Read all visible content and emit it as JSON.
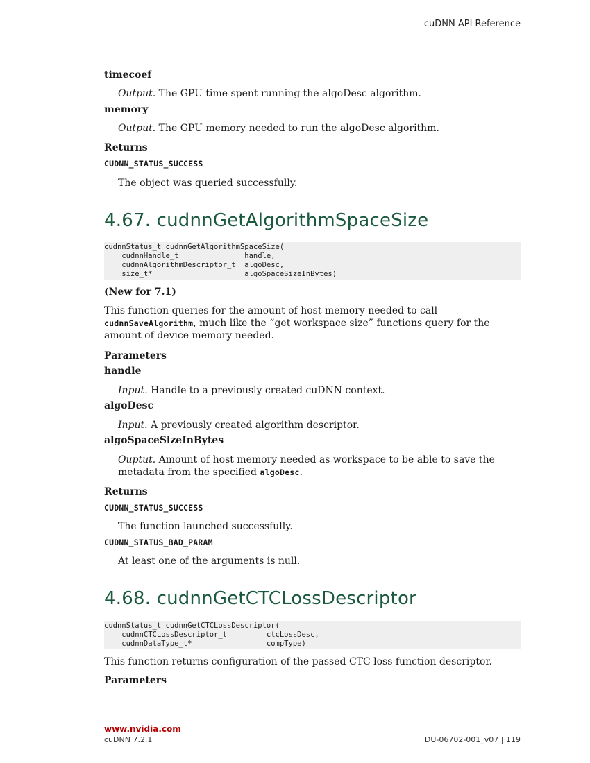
{
  "header": {
    "title": "cuDNN API Reference"
  },
  "prev_section": {
    "param_timecoef": {
      "name": "timecoef",
      "role": "Output.",
      "desc": "The GPU time spent running the algoDesc algorithm."
    },
    "param_memory": {
      "name": "memory",
      "role": "Output.",
      "desc": "The GPU memory needed to run the algoDesc algorithm."
    },
    "returns_label": "Returns",
    "return_success": {
      "code": "CUDNN_STATUS_SUCCESS",
      "desc": "The object was queried successfully."
    }
  },
  "section_467": {
    "heading": "4.67. cudnnGetAlgorithmSpaceSize",
    "code": "cudnnStatus_t cudnnGetAlgorithmSpaceSize(\n    cudnnHandle_t               handle,\n    cudnnAlgorithmDescriptor_t  algoDesc,\n    size_t*                     algoSpaceSizeInBytes)",
    "new_note": "(New for 7.1)",
    "desc_part1": "This function queries for the amount of host memory needed to call",
    "desc_code": "cudnnSaveAlgorithm",
    "desc_part2": ", much like the “get workspace size” functions query for the",
    "desc_part3": "amount of device memory needed.",
    "parameters_label": "Parameters",
    "param_handle": {
      "name": "handle",
      "role": "Input.",
      "desc": "Handle to a previously created cuDNN context."
    },
    "param_algoDesc": {
      "name": "algoDesc",
      "role": "Input.",
      "desc": "A previously created algorithm descriptor."
    },
    "param_algoSpace": {
      "name": "algoSpaceSizeInBytes",
      "role": "Ouptut.",
      "desc_line1": "Amount of host memory needed as workspace to be able to save the",
      "desc_line2_pre": "metadata from the specified ",
      "desc_code": "algoDesc",
      "desc_line2_post": "."
    },
    "returns_label": "Returns",
    "return_success": {
      "code": "CUDNN_STATUS_SUCCESS",
      "desc": "The function launched successfully."
    },
    "return_bad_param": {
      "code": "CUDNN_STATUS_BAD_PARAM",
      "desc": "At least one of the arguments is null."
    }
  },
  "section_468": {
    "heading": "4.68. cudnnGetCTCLossDescriptor",
    "code": "cudnnStatus_t cudnnGetCTCLossDescriptor(\n    cudnnCTCLossDescriptor_t         ctcLossDesc,\n    cudnnDataType_t*                 compType)",
    "desc": "This function returns configuration of the passed CTC loss function descriptor.",
    "parameters_label": "Parameters"
  },
  "footer": {
    "link": "www.nvidia.com",
    "version": "cuDNN 7.2.1",
    "doc_id": "DU-06702-001_v07  |  119"
  }
}
